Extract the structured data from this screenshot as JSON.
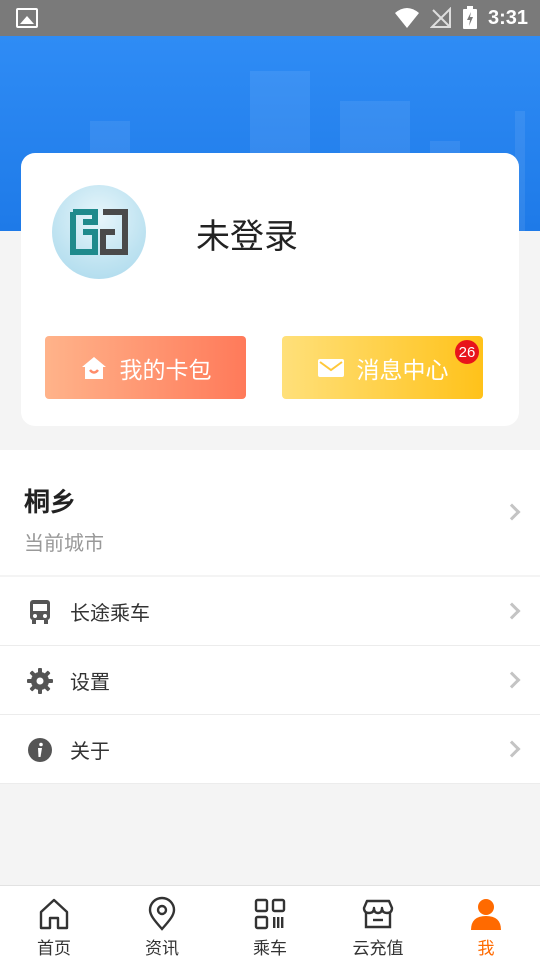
{
  "status_bar": {
    "time": "3:31"
  },
  "profile": {
    "username": "未登录",
    "wallet_label": "我的卡包",
    "messages_label": "消息中心",
    "messages_badge": "26"
  },
  "city": {
    "name": "桐乡",
    "subtitle": "当前城市"
  },
  "menu": {
    "items": [
      {
        "label": "长途乘车",
        "icon": "bus-icon"
      },
      {
        "label": "设置",
        "icon": "gear-icon"
      },
      {
        "label": "关于",
        "icon": "info-icon"
      }
    ]
  },
  "bottom_nav": {
    "items": [
      {
        "label": "首页",
        "icon": "home-icon"
      },
      {
        "label": "资讯",
        "icon": "location-pin-icon"
      },
      {
        "label": "乘车",
        "icon": "qr-code-icon"
      },
      {
        "label": "云充值",
        "icon": "store-icon"
      },
      {
        "label": "我",
        "icon": "user-icon"
      }
    ],
    "active": "我"
  },
  "colors": {
    "header_blue": "#2f8cf5",
    "accent_orange": "#ff6a00",
    "badge_red": "#e8141b"
  }
}
